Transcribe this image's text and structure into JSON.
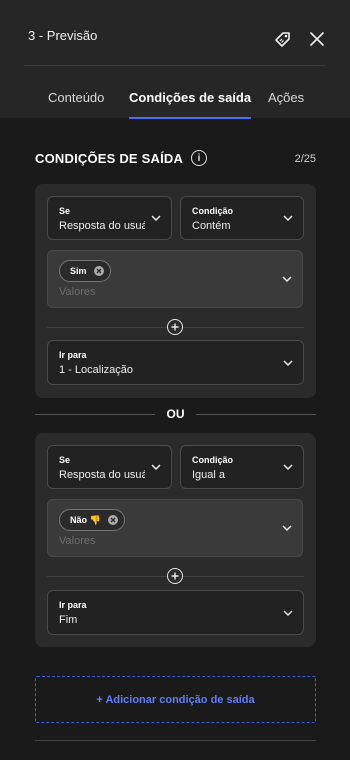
{
  "header": {
    "title": "3 - Previsão",
    "icons": [
      "tag-icon",
      "close-icon"
    ]
  },
  "tabs": [
    {
      "label": "Conteúdo",
      "active": false
    },
    {
      "label": "Condições de saída",
      "active": true
    },
    {
      "label": "Ações",
      "active": false
    }
  ],
  "section": {
    "title": "CONDIÇÕES DE SAÍDA",
    "counter": "2/25"
  },
  "separator_label": "OU",
  "conditions": [
    {
      "se_label": "Se",
      "se_value": "Resposta do usuário",
      "condicao_label": "Condição",
      "condicao_value": "Contém",
      "chip": "Sim",
      "values_placeholder": "Valores",
      "ir_para_label": "Ir para",
      "ir_para_value": "1 - Localização"
    },
    {
      "se_label": "Se",
      "se_value": "Resposta do usuário",
      "condicao_label": "Condição",
      "condicao_value": "Igual a",
      "chip": "Não 👎",
      "values_placeholder": "Valores",
      "ir_para_label": "Ir para",
      "ir_para_value": "Fim"
    }
  ],
  "add_button_label": "+ Adicionar condição de saída",
  "colors": {
    "accent": "#4f6df0",
    "background": "#1a1a1a",
    "card": "#2b2b2b"
  }
}
